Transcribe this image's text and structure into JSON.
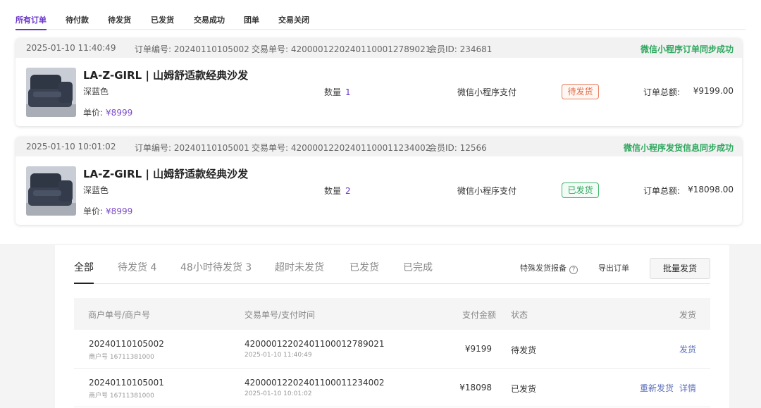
{
  "top_tabs": [
    "所有订单",
    "待付款",
    "待发货",
    "已发货",
    "交易成功",
    "团单",
    "交易关闭"
  ],
  "orders": [
    {
      "time": "2025-01-10 11:40:49",
      "order_no": "订单编号: 20240110105002",
      "trade_no": "交易单号: 4200001220240110001278902​1",
      "member_id": "会员ID: 234681",
      "sync_status": "微信小程序订单同步成功",
      "product_name": "LA-Z-GIRL | 山姆舒适款经典沙发",
      "color": "深蓝色",
      "price_label": "单价:",
      "price_value": "¥8999",
      "qty_label": "数量",
      "qty_value": "1",
      "pay_method": "微信小程序支付",
      "status": "待发货",
      "total_label": "订单总额:",
      "total_value": "¥9199.00"
    },
    {
      "time": "2025-01-10 10:01:02",
      "order_no": "订单编号: 20240110105001",
      "trade_no": "交易单号: 4200001220240110001123400​2",
      "member_id": "会员ID: 12566",
      "sync_status": "微信小程序发货信息同步成功",
      "product_name": "LA-Z-GIRL | 山姆舒适款经典沙发",
      "color": "深蓝色",
      "price_label": "单价:",
      "price_value": "¥8999",
      "qty_label": "数量",
      "qty_value": "2",
      "pay_method": "微信小程序支付",
      "status": "已发货",
      "total_label": "订单总额:",
      "total_value": "¥18098.00"
    }
  ],
  "shipping": {
    "tabs": [
      "全部",
      "待发货 4",
      "48小时待发货 3",
      "超时未发货",
      "已发货",
      "已完成"
    ],
    "report_link": "特殊发货报备",
    "export_link": "导出订单",
    "batch_button": "批量发货",
    "headers": {
      "merchant": "商户单号/商户号",
      "trade": "交易单号/支付时间",
      "amount": "支付金额",
      "status": "状态",
      "action": "发货"
    },
    "rows": [
      {
        "merchant_no": "20240110105002",
        "merchant_id": "商户号 16711381000",
        "trade_no": "4200001220240110001278902​1",
        "pay_time": "2025-01-10 11:40:49",
        "amount": "¥9199",
        "status": "待发货",
        "actions": [
          "发货"
        ]
      },
      {
        "merchant_no": "20240110105001",
        "merchant_id": "商户号 16711381000",
        "trade_no": "4200001220240110001123400​2",
        "pay_time": "2025-01-10 10:01:02",
        "amount": "¥18098",
        "status": "已发货",
        "actions": [
          "重新发货",
          "详情"
        ]
      }
    ]
  }
}
